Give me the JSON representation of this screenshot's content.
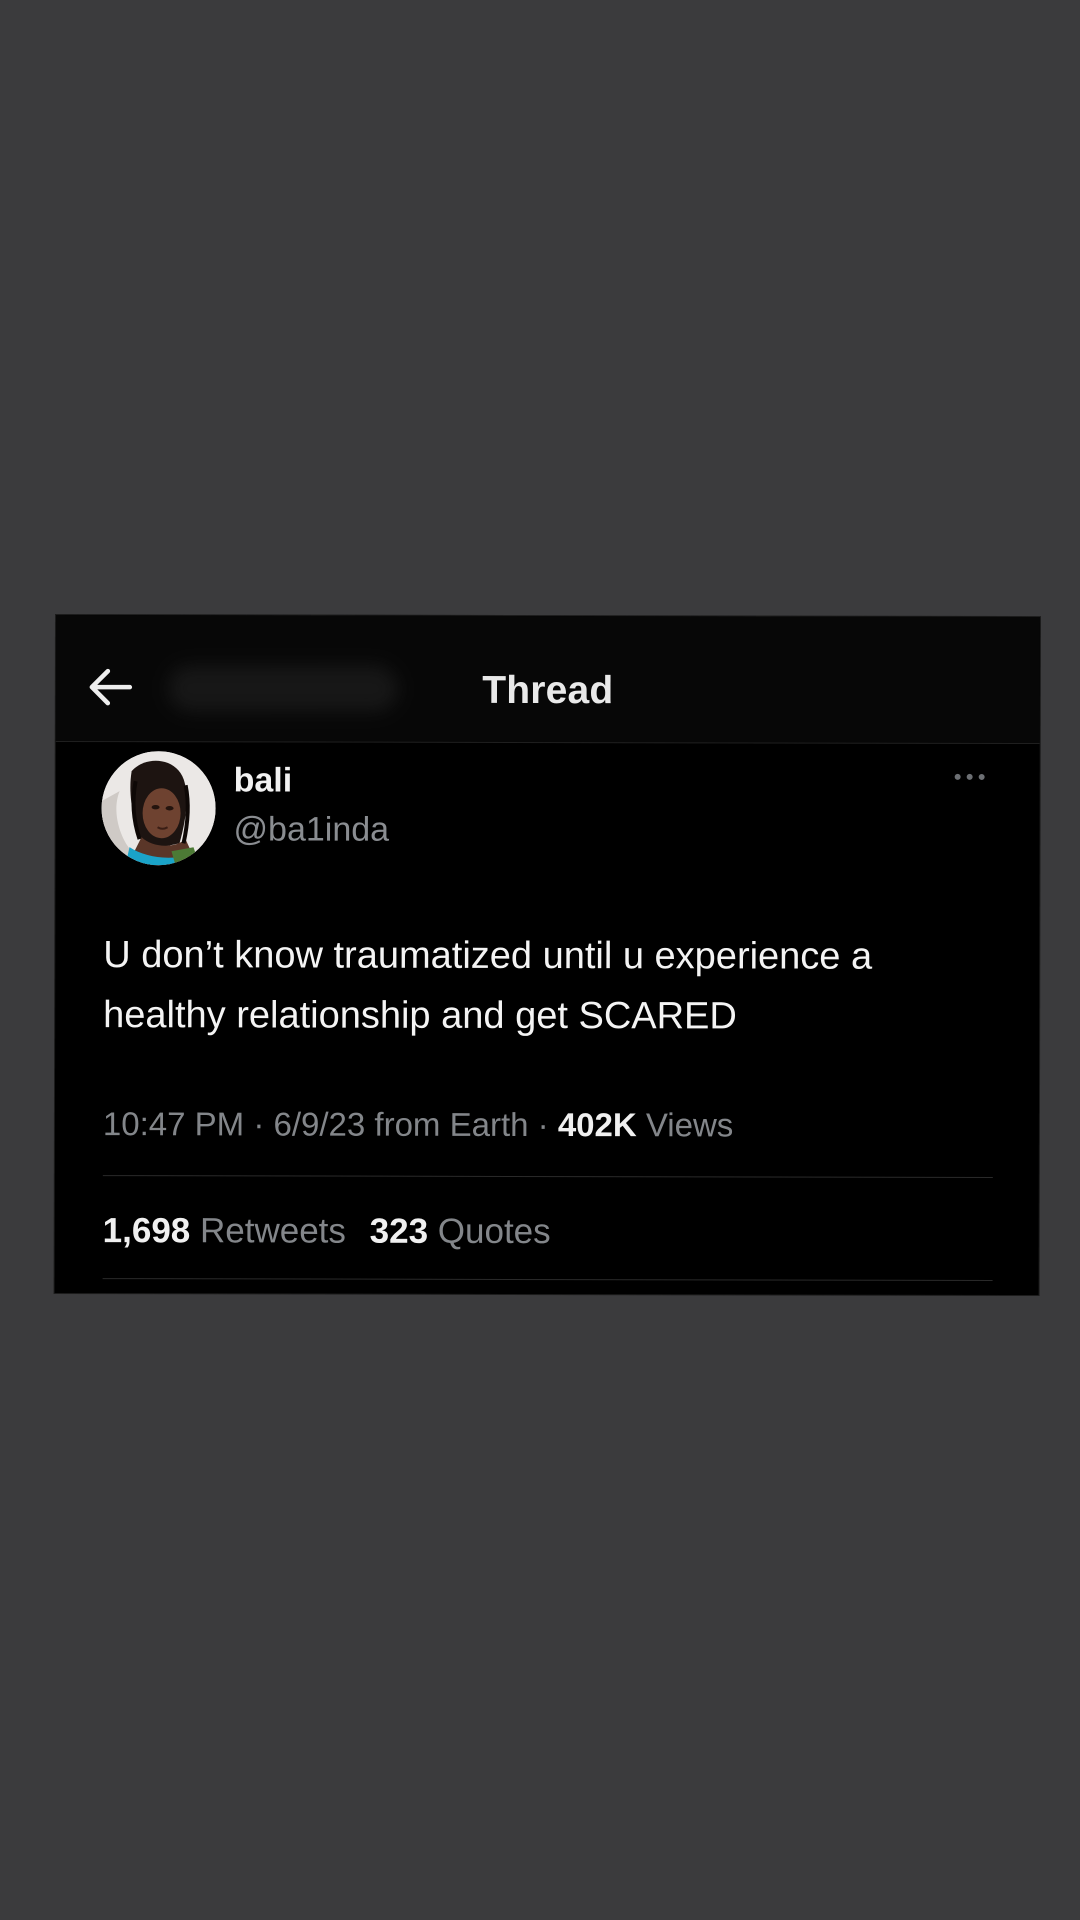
{
  "header": {
    "title": "Thread",
    "back_icon": "arrow-left-icon"
  },
  "tweet": {
    "display_name": "bali",
    "handle": "@ba1inda",
    "more_icon": "more-horizontal-icon",
    "text": "U don’t know traumatized until u experience a healthy relationship and get SCARED",
    "time": "10:47 PM",
    "date": "6/9/23",
    "source": "from Earth",
    "views_count": "402K",
    "views_label": "Views",
    "separator": "·"
  },
  "stats": {
    "retweets_count": "1,698",
    "retweets_label": "Retweets",
    "quotes_count": "323",
    "quotes_label": "Quotes"
  },
  "colors": {
    "page_background": "#3b3b3d",
    "card_background": "#000000",
    "primary_text": "#f4f4f4",
    "secondary_text": "#83868a"
  }
}
